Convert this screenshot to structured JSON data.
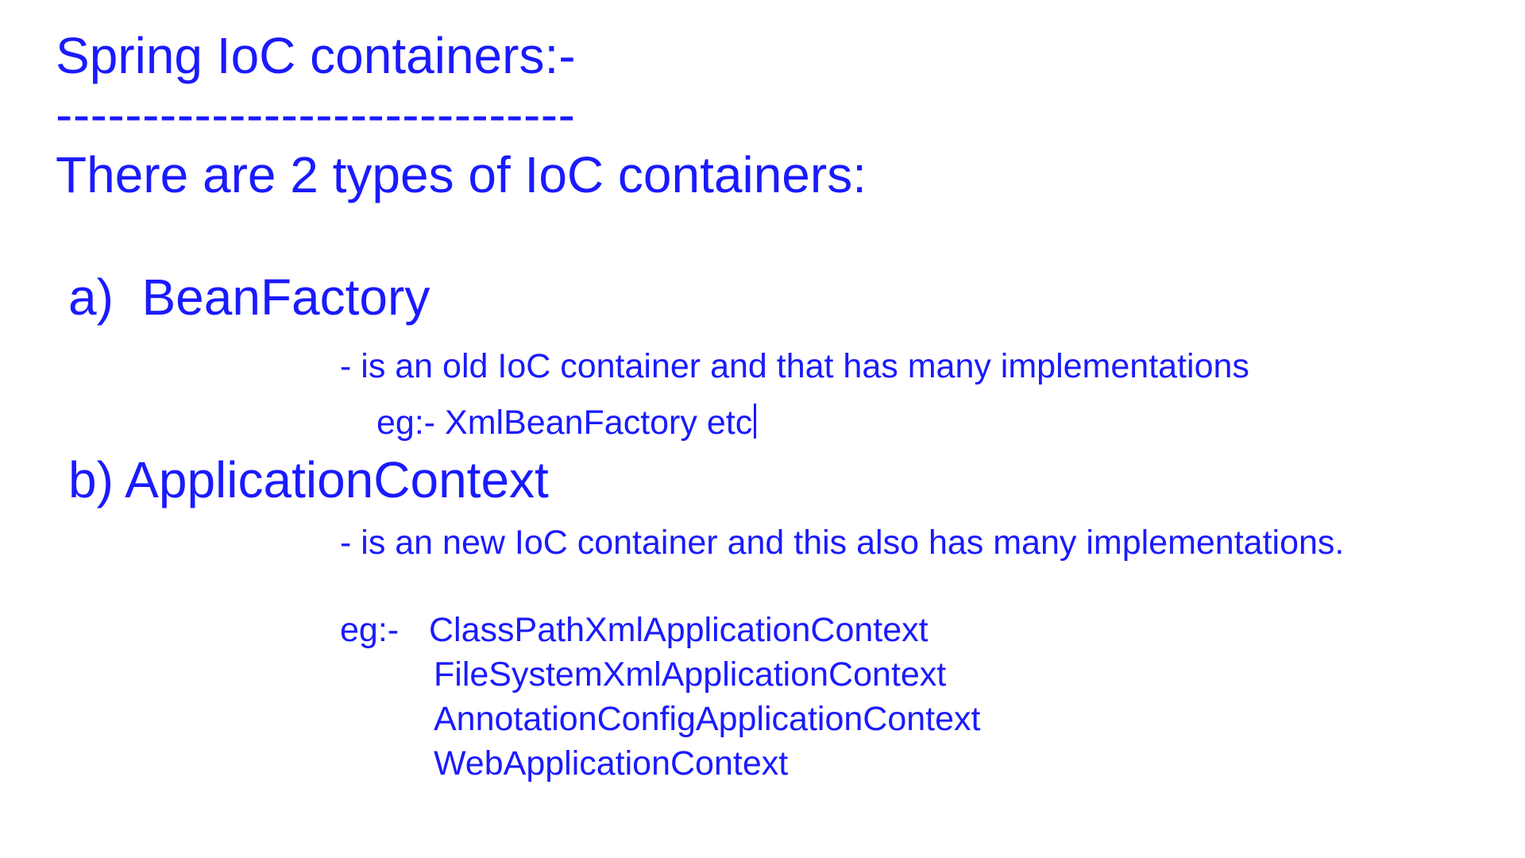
{
  "document": {
    "title": "Spring IoC containers:-",
    "divider": "------------------------------",
    "intro": "There are 2 types of IoC containers:",
    "section_a": {
      "heading": "a)  BeanFactory",
      "description": "- is an old IoC container and that has many implementations",
      "example": "eg:- XmlBeanFactory etc"
    },
    "section_b": {
      "heading": "b) ApplicationContext",
      "description": "- is an new IoC container and this also has many implementations.",
      "example_label": "eg:-",
      "examples": [
        "ClassPathXmlApplicationContext",
        "FileSystemXmlApplicationContext",
        "AnnotationConfigApplicationContext",
        "WebApplicationContext"
      ]
    }
  },
  "colors": {
    "text": "#1a1aff",
    "background": "#ffffff"
  }
}
